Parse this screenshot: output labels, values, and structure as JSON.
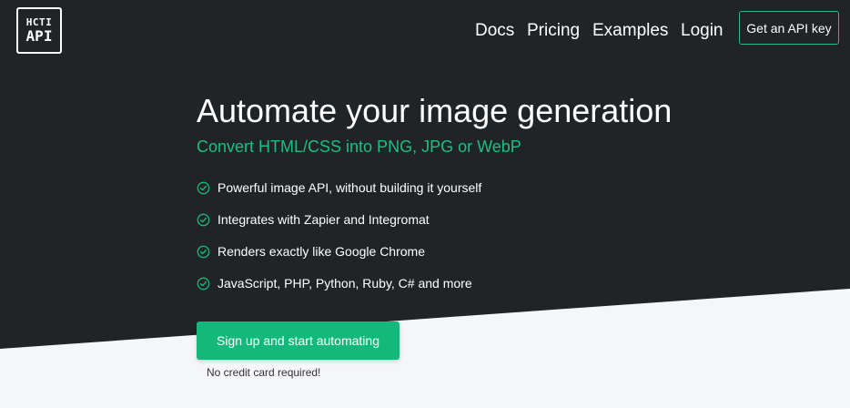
{
  "colors": {
    "hero_background": "#212427",
    "page_background": "#f5f6fa",
    "accent_green": "#13b87a",
    "subheadline_green": "#1dbf82"
  },
  "logo": {
    "line1": "HCTI",
    "line2": "API"
  },
  "nav": {
    "links": [
      "Docs",
      "Pricing",
      "Examples",
      "Login"
    ],
    "api_key_button": "Get an API key"
  },
  "hero": {
    "headline": "Automate your image generation",
    "subheadline": "Convert HTML/CSS into PNG, JPG or WebP",
    "features": [
      {
        "icon": "check-circle-icon",
        "text": "Powerful image API, without building it yourself"
      },
      {
        "icon": "check-circle-icon",
        "text": "Integrates with Zapier and Integromat"
      },
      {
        "icon": "check-circle-icon",
        "text": "Renders exactly like Google Chrome"
      },
      {
        "icon": "check-circle-icon",
        "text": "JavaScript, PHP, Python, Ruby, C# and more"
      }
    ],
    "cta_label": "Sign up and start automating",
    "note": "No credit card required!"
  }
}
